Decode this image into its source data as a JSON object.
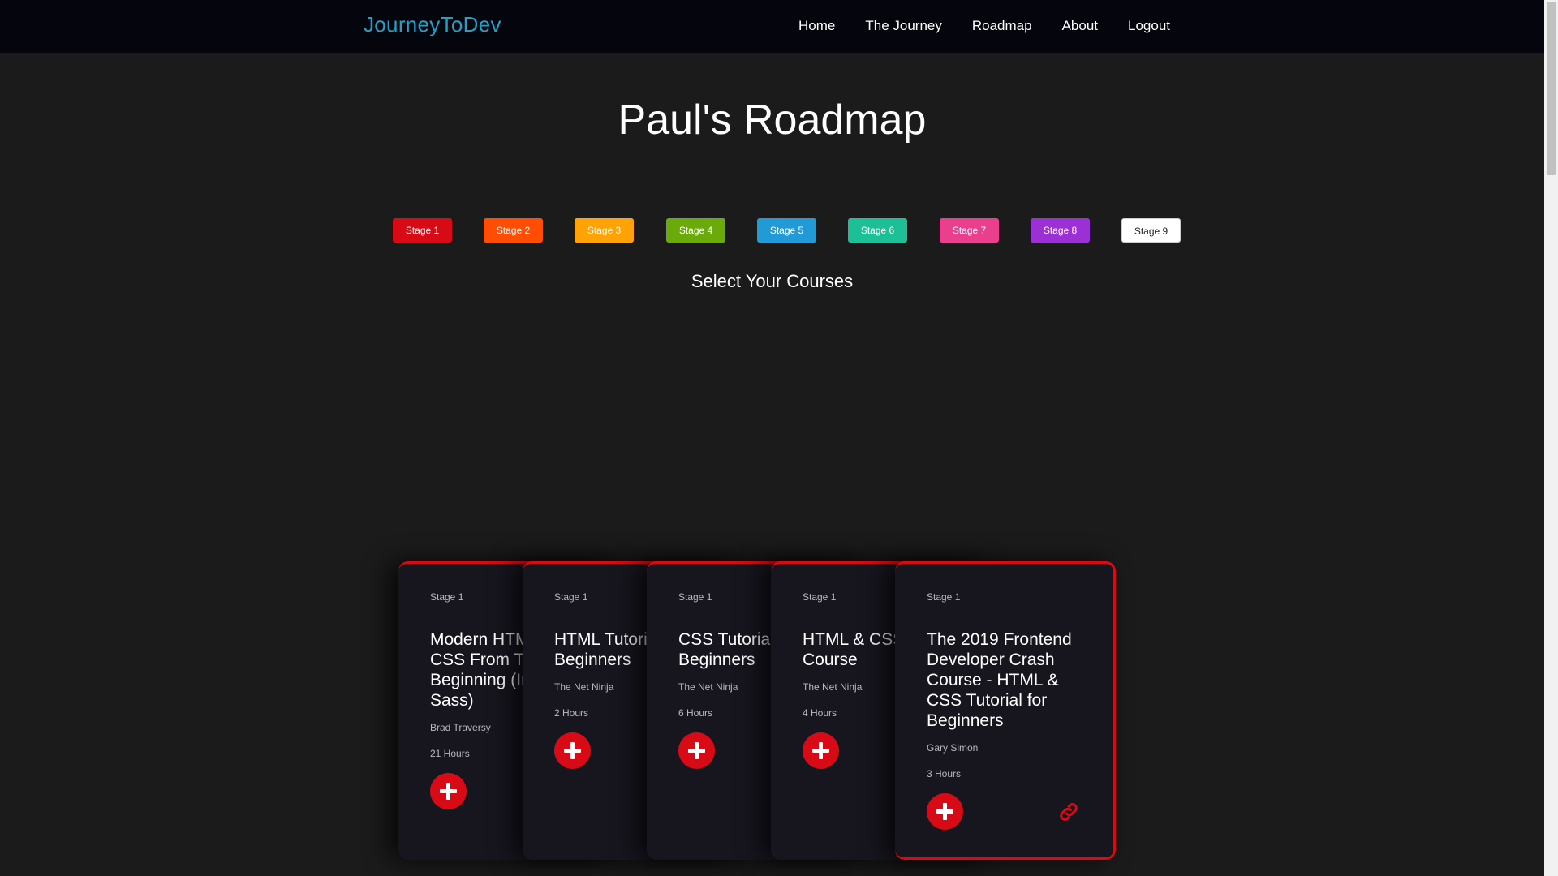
{
  "navbar": {
    "brand": "JourneyToDev",
    "links": [
      "Home",
      "The Journey",
      "Roadmap",
      "About",
      "Logout"
    ]
  },
  "page_title": "Paul's Roadmap",
  "stages": [
    {
      "label": "Stage 1",
      "color": "#d80a16"
    },
    {
      "label": "Stage 2",
      "color": "#ff4d05"
    },
    {
      "label": "Stage 3",
      "color": "#ffa205"
    },
    {
      "label": "Stage 4",
      "color": "#6aab0b"
    },
    {
      "label": "Stage 5",
      "color": "#239ad8"
    },
    {
      "label": "Stage 6",
      "color": "#1cbf96"
    },
    {
      "label": "Stage 7",
      "color": "#ea3f8d"
    },
    {
      "label": "Stage 8",
      "color": "#9b31d4"
    },
    {
      "label": "Stage 9",
      "color": "#ffffff"
    }
  ],
  "subtitle": "Select Your Courses",
  "courses": [
    {
      "stage": "Stage 1",
      "title": "Modern HTML & CSS From The Beginning (Including Sass)",
      "author": "Brad Traversy",
      "duration": "21 Hours"
    },
    {
      "stage": "Stage 1",
      "title": "HTML Tutorial for Beginners",
      "author": "The Net Ninja",
      "duration": "2 Hours"
    },
    {
      "stage": "Stage 1",
      "title": "CSS Tutorial for Beginners",
      "author": "The Net Ninja",
      "duration": "6 Hours"
    },
    {
      "stage": "Stage 1",
      "title": "HTML & CSS Crash Course",
      "author": "The Net Ninja",
      "duration": "4 Hours"
    },
    {
      "stage": "Stage 1",
      "title": "The 2019 Frontend Developer Crash Course - HTML & CSS Tutorial for Beginners",
      "author": "Gary Simon",
      "duration": "3 Hours"
    }
  ],
  "accent_color": "#d80a16",
  "brand_color": "#1fa2c9",
  "icons": {
    "add": "plus-icon",
    "link": "link-icon"
  }
}
